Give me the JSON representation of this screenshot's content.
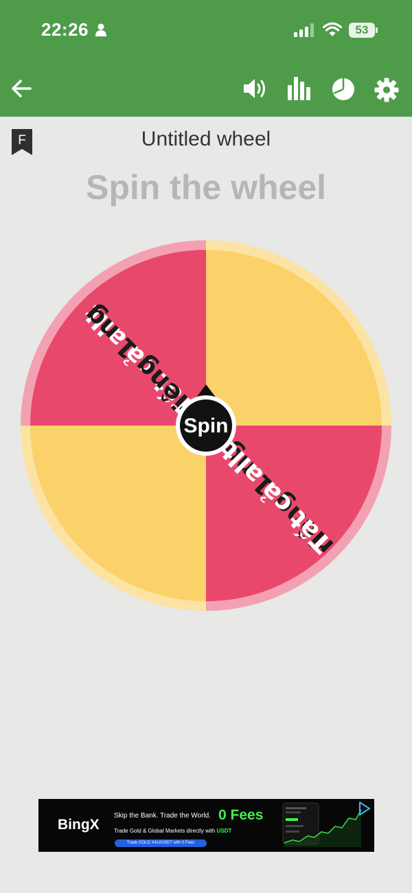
{
  "status_bar": {
    "time": "22:26",
    "battery": "53"
  },
  "toolbar": {
    "icons": [
      "back-arrow-icon",
      "sound-icon",
      "stats-icon",
      "pie-chart-icon",
      "gear-icon"
    ]
  },
  "bookmark_letter": "F",
  "wheel": {
    "title": "Untitled wheel",
    "heading": "Spin the wheel",
    "spin_label": "Spin",
    "segments": [
      {
        "label": "Tất cả allt",
        "color": "#e9486d"
      },
      {
        "label": "riêng 1 ng",
        "color": "#fbd26a"
      },
      {
        "label": "Tất cả allt",
        "color": "#e9486d"
      },
      {
        "label": "riêng 1 ng",
        "color": "#fbd26a"
      }
    ],
    "label_color_on_pink": "#ffffff",
    "label_color_on_yellow": "#1b1b1b"
  },
  "theme": {
    "header_color": "#4e9c4a",
    "background": "#e8e8e6"
  },
  "ad": {
    "brand": "BingX",
    "headline": "Skip the Bank. Trade the World.",
    "highlight": "0 Fees",
    "sub_prefix": "Trade Gold & Global Markets directly with",
    "sub_accent": "USDT",
    "cta": "Trade GOLD XAU/USDT with 0 Fees"
  }
}
